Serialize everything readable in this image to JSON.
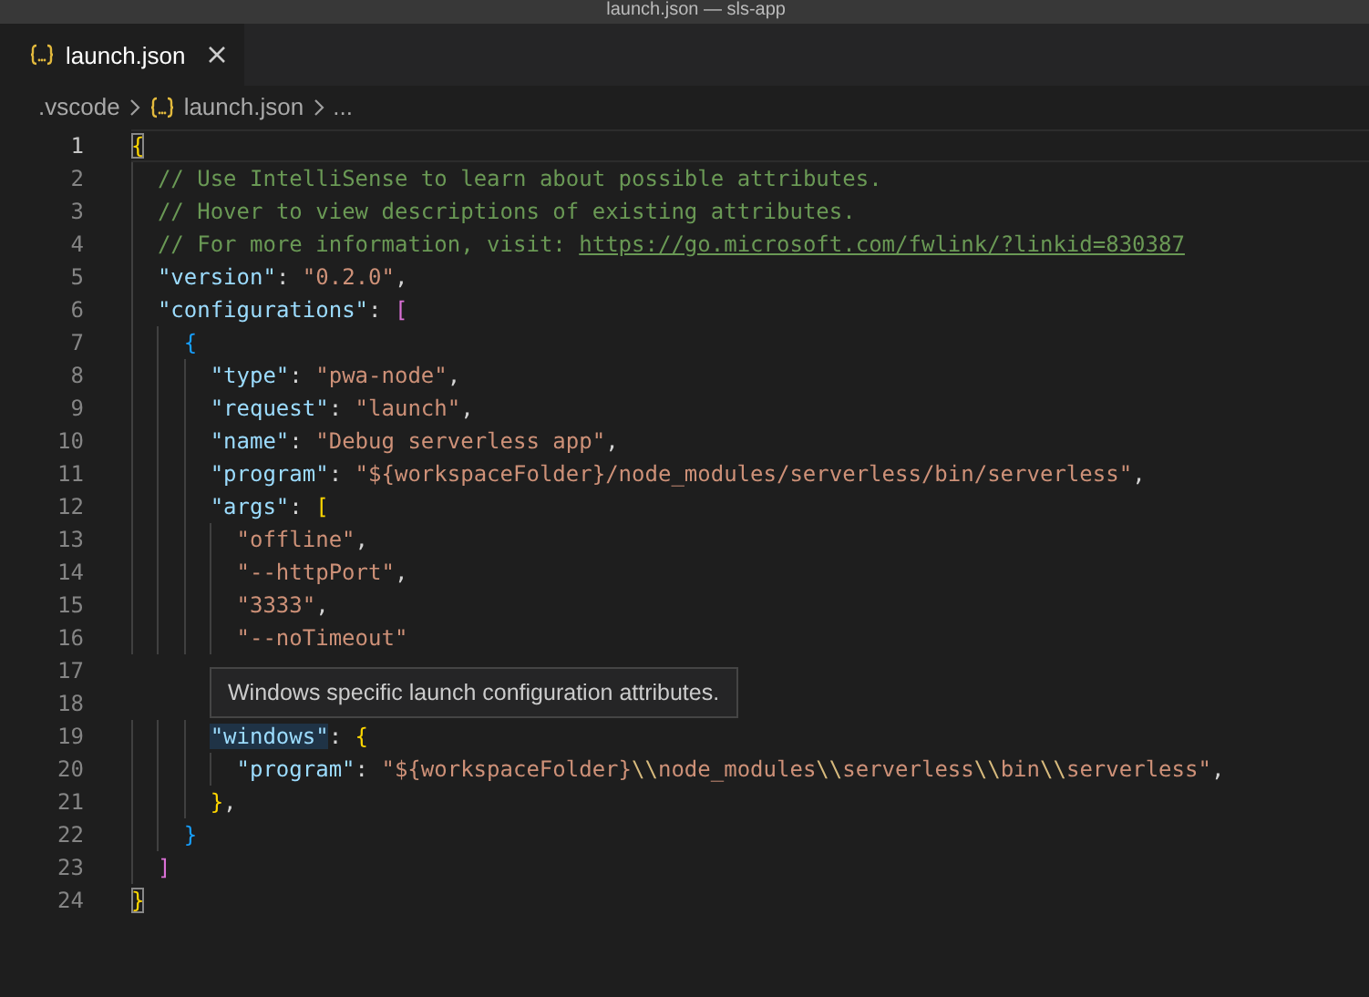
{
  "window": {
    "title": "launch.json — sls-app"
  },
  "tabs": [
    {
      "label": "launch.json",
      "selected": true
    }
  ],
  "breadcrumb": {
    "folder": ".vscode",
    "file": "launch.json",
    "more": "..."
  },
  "editor": {
    "lines": [
      {
        "number": "1",
        "current": true,
        "tokens": [
          {
            "kind": "b1m",
            "text": "{"
          }
        ]
      },
      {
        "number": "2",
        "current": false,
        "tokens": [
          {
            "kind": "comment",
            "text": "  // Use IntelliSense to learn about possible attributes."
          }
        ]
      },
      {
        "number": "3",
        "current": false,
        "tokens": [
          {
            "kind": "comment",
            "text": "  // Hover to view descriptions of existing attributes."
          }
        ]
      },
      {
        "number": "4",
        "current": false,
        "tokens": [
          {
            "kind": "comment",
            "text": "  // For more information, visit: "
          },
          {
            "kind": "link",
            "text": "https://go.microsoft.com/fwlink/?linkid=830387"
          }
        ]
      },
      {
        "number": "5",
        "current": false,
        "tokens": [
          {
            "kind": "key",
            "text": "  \"version\""
          },
          {
            "kind": "punct",
            "text": ": "
          },
          {
            "kind": "str",
            "text": "\"0.2.0\""
          },
          {
            "kind": "punct",
            "text": ","
          }
        ]
      },
      {
        "number": "6",
        "current": false,
        "tokens": [
          {
            "kind": "key",
            "text": "  \"configurations\""
          },
          {
            "kind": "punct",
            "text": ": "
          },
          {
            "kind": "b2",
            "text": "["
          }
        ]
      },
      {
        "number": "7",
        "current": false,
        "tokens": [
          {
            "kind": "b3",
            "text": "    {"
          }
        ]
      },
      {
        "number": "8",
        "current": false,
        "tokens": [
          {
            "kind": "key",
            "text": "      \"type\""
          },
          {
            "kind": "punct",
            "text": ": "
          },
          {
            "kind": "str",
            "text": "\"pwa-node\""
          },
          {
            "kind": "punct",
            "text": ","
          }
        ]
      },
      {
        "number": "9",
        "current": false,
        "tokens": [
          {
            "kind": "key",
            "text": "      \"request\""
          },
          {
            "kind": "punct",
            "text": ": "
          },
          {
            "kind": "str",
            "text": "\"launch\""
          },
          {
            "kind": "punct",
            "text": ","
          }
        ]
      },
      {
        "number": "10",
        "current": false,
        "tokens": [
          {
            "kind": "key",
            "text": "      \"name\""
          },
          {
            "kind": "punct",
            "text": ": "
          },
          {
            "kind": "str",
            "text": "\"Debug serverless app\""
          },
          {
            "kind": "punct",
            "text": ","
          }
        ]
      },
      {
        "number": "11",
        "current": false,
        "tokens": [
          {
            "kind": "key",
            "text": "      \"program\""
          },
          {
            "kind": "punct",
            "text": ": "
          },
          {
            "kind": "str",
            "text": "\"${workspaceFolder}/node_modules/serverless/bin/serverless\""
          },
          {
            "kind": "punct",
            "text": ","
          }
        ]
      },
      {
        "number": "12",
        "current": false,
        "tokens": [
          {
            "kind": "key",
            "text": "      \"args\""
          },
          {
            "kind": "punct",
            "text": ": "
          },
          {
            "kind": "b1",
            "text": "["
          }
        ]
      },
      {
        "number": "13",
        "current": false,
        "tokens": [
          {
            "kind": "str",
            "text": "        \"offline\""
          },
          {
            "kind": "punct",
            "text": ","
          }
        ]
      },
      {
        "number": "14",
        "current": false,
        "tokens": [
          {
            "kind": "str",
            "text": "        \"--httpPort\""
          },
          {
            "kind": "punct",
            "text": ","
          }
        ]
      },
      {
        "number": "15",
        "current": false,
        "tokens": [
          {
            "kind": "str",
            "text": "        \"3333\""
          },
          {
            "kind": "punct",
            "text": ","
          }
        ]
      },
      {
        "number": "16",
        "current": false,
        "tokens": [
          {
            "kind": "str",
            "text": "        \"--noTimeout\""
          }
        ]
      },
      {
        "number": "17",
        "current": false
      },
      {
        "number": "18",
        "current": false
      },
      {
        "number": "19",
        "current": false,
        "tokens": [
          {
            "kind": "keyh",
            "text": "      \"windows\""
          },
          {
            "kind": "punct",
            "text": ": "
          },
          {
            "kind": "b1",
            "text": "{"
          }
        ]
      },
      {
        "number": "20",
        "current": false,
        "tokens": [
          {
            "kind": "key",
            "text": "        \"program\""
          },
          {
            "kind": "punct",
            "text": ": "
          },
          {
            "kind": "str",
            "text": "\"${workspaceFolder}"
          },
          {
            "kind": "escape",
            "text": "\\\\"
          },
          {
            "kind": "str",
            "text": "node_modules"
          },
          {
            "kind": "escape",
            "text": "\\\\"
          },
          {
            "kind": "str",
            "text": "serverless"
          },
          {
            "kind": "escape",
            "text": "\\\\"
          },
          {
            "kind": "str",
            "text": "bin"
          },
          {
            "kind": "escape",
            "text": "\\\\"
          },
          {
            "kind": "str",
            "text": "serverless\""
          },
          {
            "kind": "punct",
            "text": ","
          }
        ]
      },
      {
        "number": "21",
        "current": false,
        "tokens": [
          {
            "kind": "b1",
            "text": "      }"
          },
          {
            "kind": "punct",
            "text": ","
          }
        ]
      },
      {
        "number": "22",
        "current": false,
        "tokens": [
          {
            "kind": "b3",
            "text": "    }"
          }
        ]
      },
      {
        "number": "23",
        "current": false,
        "tokens": [
          {
            "kind": "b2",
            "text": "  ]"
          }
        ]
      },
      {
        "number": "24",
        "current": false,
        "tokens": [
          {
            "kind": "b1m",
            "text": "}"
          }
        ]
      }
    ]
  },
  "tooltip": {
    "text": "Windows specific launch configuration attributes."
  }
}
